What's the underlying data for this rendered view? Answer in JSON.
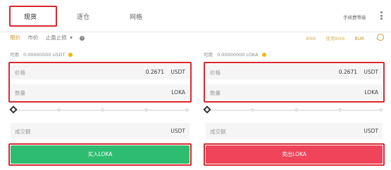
{
  "tabs": {
    "spot": "现货",
    "margin": "逐仓",
    "grid": "网格",
    "right_link": "手续费等级"
  },
  "order_types": {
    "limit": "限价",
    "market": "市价",
    "stop_limit": "止盈止损"
  },
  "right_pills": [
    "BNB",
    "使用BNB",
    "BUR"
  ],
  "buy": {
    "available_label": "可用",
    "available_value": "0.00000000 USDT",
    "price_label": "价格",
    "price_value": "0.2671",
    "price_unit": "USDT",
    "amount_label": "数量",
    "amount_unit": "LOKA",
    "total_label": "成交额",
    "total_unit": "USDT",
    "button": "买入LOKA"
  },
  "sell": {
    "available_label": "可用",
    "available_value": "0.00000000 LOKA",
    "price_label": "价格",
    "price_value": "0.2671",
    "price_unit": "USDT",
    "amount_label": "数量",
    "amount_unit": "LOKA",
    "total_label": "成交额",
    "total_unit": "USDT",
    "button": "卖出LOKA"
  },
  "colors": {
    "buy": "#2ebd70",
    "sell": "#f0445a",
    "accent": "#c49a2a",
    "highlight": "#d9282e"
  }
}
